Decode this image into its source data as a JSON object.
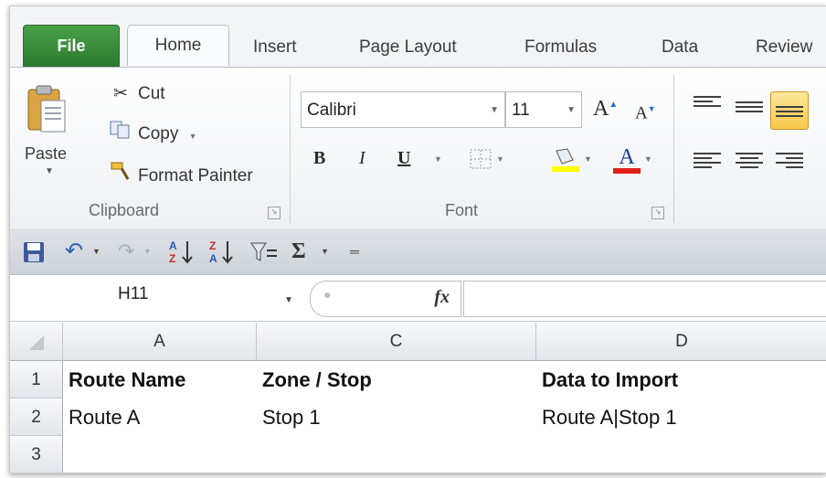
{
  "tabs": [
    "File",
    "Home",
    "Insert",
    "Page Layout",
    "Formulas",
    "Data",
    "Review"
  ],
  "clipboard": {
    "paste_label": "Paste",
    "cut_label": "Cut",
    "copy_label": "Copy",
    "format_painter_label": "Format Painter",
    "group_label": "Clipboard"
  },
  "font": {
    "font_name": "Calibri",
    "font_size": "11",
    "bold_label": "B",
    "italic_label": "I",
    "underline_label": "U",
    "font_color_label": "A",
    "group_label": "Font",
    "highlight_color": "#ffff00",
    "font_color": "#e0201a"
  },
  "qat": {
    "sigma_label": "Σ"
  },
  "formula_bar": {
    "name_box": "H11",
    "fx_label": "fx",
    "formula": ""
  },
  "sheet": {
    "columns": [
      "A",
      "C",
      "D"
    ],
    "rows": [
      {
        "num": "1",
        "cells": [
          "Route Name",
          "Zone / Stop",
          "Data to Import"
        ]
      },
      {
        "num": "2",
        "cells": [
          "Route A",
          "Stop 1",
          "Route A|Stop 1"
        ]
      },
      {
        "num": "3",
        "cells": [
          "",
          "",
          ""
        ]
      }
    ]
  },
  "colors": {
    "file_tab": "#2c7a2f",
    "selected_align": "#f7c84a"
  }
}
